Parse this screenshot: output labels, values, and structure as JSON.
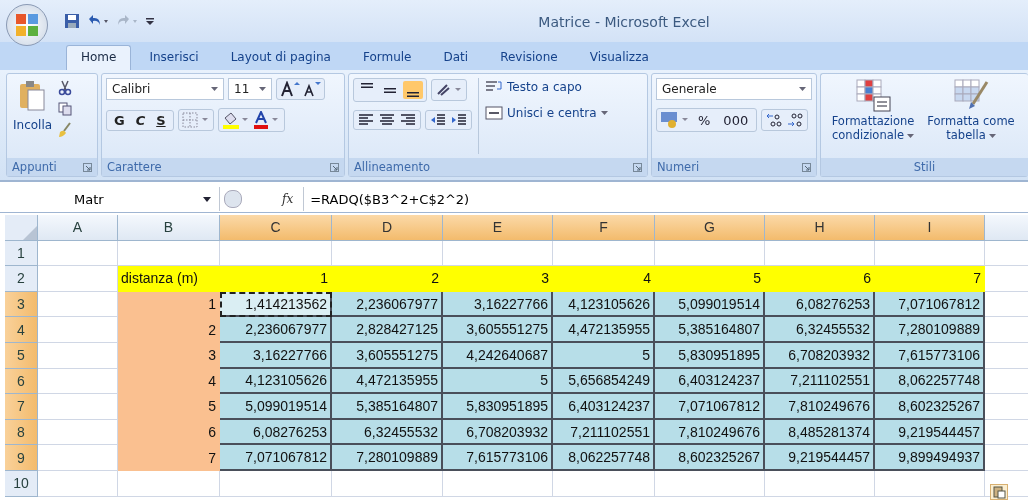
{
  "window": {
    "title": "Matrice - Microsoft Excel"
  },
  "tabs": [
    {
      "label": "Home",
      "selected": true
    },
    {
      "label": "Inserisci",
      "selected": false
    },
    {
      "label": "Layout di pagina",
      "selected": false
    },
    {
      "label": "Formule",
      "selected": false
    },
    {
      "label": "Dati",
      "selected": false
    },
    {
      "label": "Revisione",
      "selected": false
    },
    {
      "label": "Visualizza",
      "selected": false
    }
  ],
  "ribbon": {
    "clipboard": {
      "label": "Appunti",
      "paste": "Incolla"
    },
    "font": {
      "label": "Carattere",
      "family": "Calibri",
      "size": "11",
      "bold": "G",
      "italic": "C",
      "underline": "S"
    },
    "alignment": {
      "label": "Allineamento",
      "vertical": [
        {
          "selected": false
        },
        {
          "selected": false
        },
        {
          "selected": true
        }
      ],
      "wrap": "Testo a capo",
      "merge": "Unisci e centra"
    },
    "number": {
      "label": "Numeri",
      "format": "Generale",
      "percent": "%",
      "thousands": "000"
    },
    "styles": {
      "label": "Stili",
      "conditional": "Formattazione condizionale",
      "table": "Formatta come tabella"
    }
  },
  "formula_bar": {
    "name_box": "Matr",
    "function_label": "fx",
    "formula": "=RADQ($B3^2+C$2^2)"
  },
  "sheet": {
    "columns": [
      {
        "label": "A",
        "selected": false
      },
      {
        "label": "B",
        "selected": false
      },
      {
        "label": "C",
        "selected": true
      },
      {
        "label": "D",
        "selected": true
      },
      {
        "label": "E",
        "selected": true
      },
      {
        "label": "F",
        "selected": true
      },
      {
        "label": "G",
        "selected": true
      },
      {
        "label": "H",
        "selected": true
      },
      {
        "label": "I",
        "selected": true
      }
    ],
    "rows": [
      {
        "label": "1",
        "selected": false,
        "kind": "empty"
      },
      {
        "label": "2",
        "selected": false,
        "kind": "header",
        "b": "distanza (m)",
        "values": [
          {
            "v": "1",
            "marquee": false
          },
          {
            "v": "2",
            "marquee": false
          },
          {
            "v": "3",
            "marquee": false
          },
          {
            "v": "4",
            "marquee": false
          },
          {
            "v": "5",
            "marquee": false
          },
          {
            "v": "6",
            "marquee": false
          },
          {
            "v": "7",
            "marquee": false
          }
        ]
      },
      {
        "label": "3",
        "selected": true,
        "kind": "data",
        "b": "1",
        "values": [
          {
            "v": "1,414213562",
            "marquee": true
          },
          {
            "v": "2,236067977",
            "marquee": false
          },
          {
            "v": "3,16227766",
            "marquee": false
          },
          {
            "v": "4,123105626",
            "marquee": false
          },
          {
            "v": "5,099019514",
            "marquee": false
          },
          {
            "v": "6,08276253",
            "marquee": false
          },
          {
            "v": "7,071067812",
            "marquee": false
          }
        ]
      },
      {
        "label": "4",
        "selected": true,
        "kind": "data",
        "b": "2",
        "values": [
          {
            "v": "2,236067977",
            "marquee": false
          },
          {
            "v": "2,828427125",
            "marquee": false
          },
          {
            "v": "3,605551275",
            "marquee": false
          },
          {
            "v": "4,472135955",
            "marquee": false
          },
          {
            "v": "5,385164807",
            "marquee": false
          },
          {
            "v": "6,32455532",
            "marquee": false
          },
          {
            "v": "7,280109889",
            "marquee": false
          }
        ]
      },
      {
        "label": "5",
        "selected": true,
        "kind": "data",
        "b": "3",
        "values": [
          {
            "v": "3,16227766",
            "marquee": false
          },
          {
            "v": "3,605551275",
            "marquee": false
          },
          {
            "v": "4,242640687",
            "marquee": false
          },
          {
            "v": "5",
            "marquee": false
          },
          {
            "v": "5,830951895",
            "marquee": false
          },
          {
            "v": "6,708203932",
            "marquee": false
          },
          {
            "v": "7,615773106",
            "marquee": false
          }
        ]
      },
      {
        "label": "6",
        "selected": true,
        "kind": "data",
        "b": "4",
        "values": [
          {
            "v": "4,123105626",
            "marquee": false
          },
          {
            "v": "4,472135955",
            "marquee": false
          },
          {
            "v": "5",
            "marquee": false
          },
          {
            "v": "5,656854249",
            "marquee": false
          },
          {
            "v": "6,403124237",
            "marquee": false
          },
          {
            "v": "7,211102551",
            "marquee": false
          },
          {
            "v": "8,062257748",
            "marquee": false
          }
        ]
      },
      {
        "label": "7",
        "selected": true,
        "kind": "data",
        "b": "5",
        "values": [
          {
            "v": "5,099019514",
            "marquee": false
          },
          {
            "v": "5,385164807",
            "marquee": false
          },
          {
            "v": "5,830951895",
            "marquee": false
          },
          {
            "v": "6,403124237",
            "marquee": false
          },
          {
            "v": "7,071067812",
            "marquee": false
          },
          {
            "v": "7,810249676",
            "marquee": false
          },
          {
            "v": "8,602325267",
            "marquee": false
          }
        ]
      },
      {
        "label": "8",
        "selected": true,
        "kind": "data",
        "b": "6",
        "values": [
          {
            "v": "6,08276253",
            "marquee": false
          },
          {
            "v": "6,32455532",
            "marquee": false
          },
          {
            "v": "6,708203932",
            "marquee": false
          },
          {
            "v": "7,211102551",
            "marquee": false
          },
          {
            "v": "7,810249676",
            "marquee": false
          },
          {
            "v": "8,485281374",
            "marquee": false
          },
          {
            "v": "9,219544457",
            "marquee": false
          }
        ]
      },
      {
        "label": "9",
        "selected": true,
        "kind": "data",
        "b": "7",
        "values": [
          {
            "v": "7,071067812",
            "marquee": false
          },
          {
            "v": "7,280109889",
            "marquee": false
          },
          {
            "v": "7,615773106",
            "marquee": false
          },
          {
            "v": "8,062257748",
            "marquee": false
          },
          {
            "v": "8,602325267",
            "marquee": false
          },
          {
            "v": "9,219544457",
            "marquee": false
          },
          {
            "v": "9,899494937",
            "marquee": false
          }
        ]
      },
      {
        "label": "10",
        "selected": false,
        "kind": "empty"
      }
    ]
  }
}
